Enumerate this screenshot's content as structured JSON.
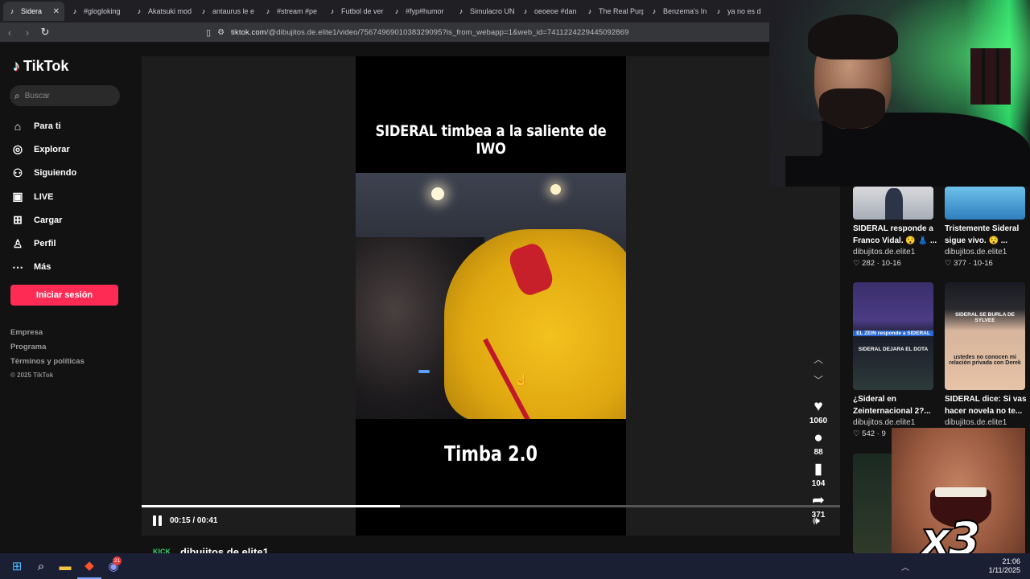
{
  "browser": {
    "tabs": [
      {
        "label": "Sidera",
        "active": true
      },
      {
        "label": "#glogloking"
      },
      {
        "label": "Akatsuki mod"
      },
      {
        "label": "antaurus le e"
      },
      {
        "label": "#stream #pe"
      },
      {
        "label": "Futbol de ver"
      },
      {
        "label": "#fyp#humor"
      },
      {
        "label": "Simulacro UN"
      },
      {
        "label": "oeoeoe #dan"
      },
      {
        "label": "The Real Purp"
      },
      {
        "label": "Benzema's In"
      },
      {
        "label": "ya no es d"
      }
    ],
    "tab_close": "✕",
    "url_host": "tiktok.com",
    "url_path": "/@dibujitos.de.elite1/video/7567496901038329095?is_from_webapp=1&web_id=7411224229445092869"
  },
  "sidebar": {
    "logo": "TikTok",
    "search_placeholder": "Buscar",
    "nav": [
      {
        "label": "Para ti",
        "icon": "home-icon"
      },
      {
        "label": "Explorar",
        "icon": "compass-icon"
      },
      {
        "label": "Siguiendo",
        "icon": "following-icon"
      },
      {
        "label": "LIVE",
        "icon": "live-icon"
      },
      {
        "label": "Cargar",
        "icon": "upload-icon"
      },
      {
        "label": "Perfil",
        "icon": "profile-icon"
      },
      {
        "label": "Más",
        "icon": "more-icon"
      }
    ],
    "login_label": "Iniciar sesión",
    "footer": [
      "Empresa",
      "Programa",
      "Términos y políticas"
    ],
    "copyright": "© 2025 TikTok"
  },
  "video": {
    "title_overlay": "SIDERAL timbea a la saliente de IWO",
    "caption_overlay": "Timba 2.0",
    "current_time": "00:15",
    "duration": "00:41",
    "timer_text": "00:15 / 00:41",
    "progress": 0.37
  },
  "actions": {
    "likes": "1060",
    "comments": "88",
    "saves": "104",
    "shares": "371"
  },
  "author": {
    "badge": "KICK",
    "name": "dibujitos.de.elite1"
  },
  "recommended": [
    {
      "title": "SIDERAL responde a Franco Vidal. 😯 👗 ...",
      "author": "dibujitos.de.elite1",
      "likes": "282",
      "date": "10-16"
    },
    {
      "title": "Tristemente Sideral sigue vivo. 😯 ...",
      "author": "dibujitos.de.elite1",
      "likes": "377",
      "date": "10-16"
    },
    {
      "title": "¿Sideral en Zeinternacional 2?...",
      "author": "dibujitos.de.elite1",
      "likes": "542",
      "date": "9"
    },
    {
      "title": "SIDERAL dice: Si vas hacer novela no te...",
      "author": "dibujitos.de.elite1",
      "likes": "",
      "date": ""
    }
  ],
  "thumb_texts": {
    "t3_top": "EL ZEIN responde a SIDERAL",
    "t3_mid": "SIDERAL DEJARA EL DOTA",
    "t4_top": "SIDERAL SE BURLA DE SYLVEE",
    "t4_mid": "ustedes no conocen mi relación privada con Derek"
  },
  "meme_text": "x3",
  "taskbar": {
    "time": "21:06",
    "date": "1/11/2025",
    "discord_badge": "21"
  },
  "colors": {
    "accent": "#fe2c55",
    "background": "#121212",
    "video_bg": "#1d1d1d"
  }
}
